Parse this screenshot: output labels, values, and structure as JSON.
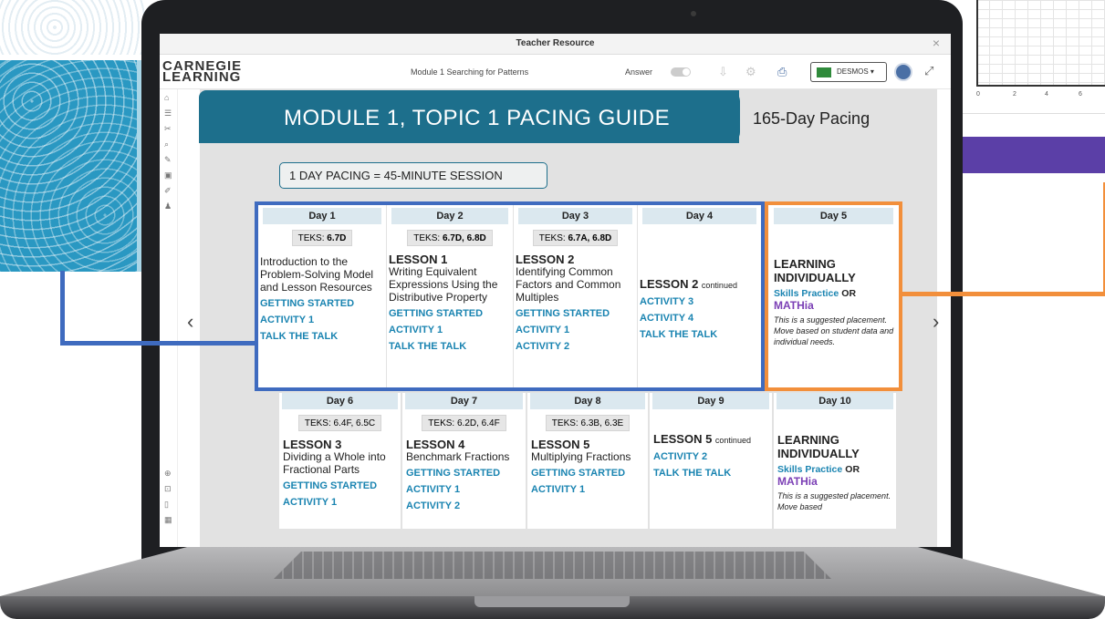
{
  "window": {
    "title": "Teacher Resource",
    "close": "×"
  },
  "toolbar": {
    "logo_line1": "CARNEGIE",
    "logo_line2": "LEARNING",
    "module": "Module 1 Searching for Patterns",
    "answer_label": "Answer",
    "desmos_label": "DESMOS ▾"
  },
  "banner": {
    "title": "MODULE 1, TOPIC 1 PACING GUIDE",
    "pacing": "165-Day Pacing"
  },
  "pacing_note": "1 DAY PACING = 45-MINUTE SESSION",
  "nav": {
    "prev": "‹",
    "next": "›"
  },
  "chart_ticks": [
    "0",
    "2",
    "4",
    "6"
  ],
  "days_top": [
    {
      "day": "Day 1",
      "teks_prefix": "TEKS:",
      "teks": "6.7D",
      "intro": "Introduction to the Problem-Solving Model and Lesson Resources",
      "activities": [
        "GETTING STARTED",
        "ACTIVITY 1",
        "TALK THE TALK"
      ]
    },
    {
      "day": "Day 2",
      "teks_prefix": "TEKS:",
      "teks": "6.7D, 6.8D",
      "lesson": "LESSON 1",
      "lesson_title": "Writing Equivalent Expressions Using the Distributive Property",
      "activities": [
        "GETTING STARTED",
        "ACTIVITY 1",
        "TALK THE TALK"
      ]
    },
    {
      "day": "Day 3",
      "teks_prefix": "TEKS:",
      "teks": "6.7A, 6.8D",
      "lesson": "LESSON 2",
      "lesson_title": "Identifying Common Factors and Common Multiples",
      "activities": [
        "GETTING STARTED",
        "ACTIVITY 1",
        "ACTIVITY 2"
      ]
    },
    {
      "day": "Day 4",
      "lesson": "LESSON 2",
      "continued": "continued",
      "activities": [
        "ACTIVITY 3",
        "ACTIVITY 4",
        "TALK THE TALK"
      ]
    },
    {
      "day": "Day 5",
      "lesson": "LEARNING INDIVIDUALLY",
      "skills": "Skills Practice",
      "or": "OR",
      "mathia": "MATHia",
      "note": "This is a suggested placement. Move based on student data and individual needs."
    }
  ],
  "days_bottom": [
    {
      "day": "Day 6",
      "teks_prefix": "TEKS:",
      "teks": "6.4F, 6.5C",
      "lesson": "LESSON 3",
      "lesson_title": "Dividing a Whole into Fractional Parts",
      "activities": [
        "GETTING STARTED",
        "ACTIVITY 1"
      ]
    },
    {
      "day": "Day 7",
      "teks_prefix": "TEKS:",
      "teks": "6.2D, 6.4F",
      "lesson": "LESSON 4",
      "lesson_title": "Benchmark Fractions",
      "activities": [
        "GETTING STARTED",
        "ACTIVITY 1",
        "ACTIVITY 2"
      ]
    },
    {
      "day": "Day 8",
      "teks_prefix": "TEKS:",
      "teks": "6.3B, 6.3E",
      "lesson": "LESSON 5",
      "lesson_title": "Multiplying Fractions",
      "activities": [
        "GETTING STARTED",
        "ACTIVITY 1"
      ]
    },
    {
      "day": "Day 9",
      "lesson": "LESSON 5",
      "continued": "continued",
      "activities": [
        "ACTIVITY 2",
        "TALK THE TALK"
      ]
    },
    {
      "day": "Day 10",
      "lesson": "LEARNING INDIVIDUALLY",
      "skills": "Skills Practice",
      "or": "OR",
      "mathia": "MATHia",
      "note": "This is a suggested placement. Move based"
    }
  ],
  "colors": {
    "teal": "#1d6f8c",
    "blue_highlight": "#3f6bbf",
    "orange_highlight": "#f28f3b",
    "activity": "#1a84b1",
    "mathia": "#7b3fb5"
  }
}
